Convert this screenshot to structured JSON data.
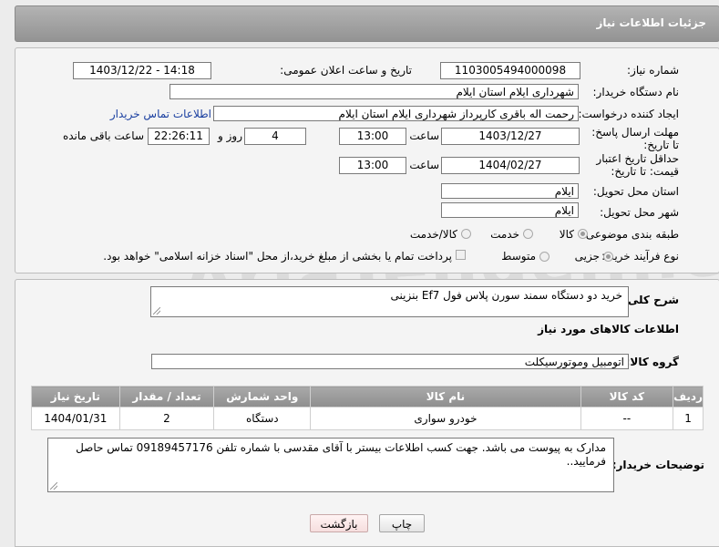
{
  "header": {
    "title": "جزئیات اطلاعات نیاز"
  },
  "labels": {
    "need_number": "شماره نیاز:",
    "announce_datetime": "تاریخ و ساعت اعلان عمومی:",
    "buyer_org": "نام دستگاه خریدار:",
    "requester": "ایجاد کننده درخواست:",
    "contact_link": "اطلاعات تماس خریدار",
    "reply_deadline": "مهلت ارسال پاسخ: تا تاریخ:",
    "price_validity": "حداقل تاریخ اعتبار قیمت: تا تاریخ:",
    "time": "ساعت",
    "day_and": "روز و",
    "remaining": "ساعت باقی مانده",
    "delivery_province": "استان محل تحویل:",
    "delivery_city": "شهر محل تحویل:",
    "category": "طبقه بندی موضوعی:",
    "purchase_type": "نوع فرآیند خرید :",
    "need_desc": "شرح کلی نیاز:",
    "goods_info": "اطلاعات کالاهای مورد نیاز",
    "goods_group": "گروه کالا:",
    "buyer_notes": "توضیحات خریدار:"
  },
  "values": {
    "need_number": "1103005494000098",
    "announce_datetime": "1403/12/22 - 14:18",
    "buyer_org": "شهرداری ایلام استان ایلام",
    "requester": "رحمت اله باقری کارپرداز شهرداری ایلام استان ایلام",
    "reply_date": "1403/12/27",
    "reply_time": "13:00",
    "days": "4",
    "remaining_time": "22:26:11",
    "validity_date": "1404/02/27",
    "validity_time": "13:00",
    "delivery_province": "ایلام",
    "delivery_city": "ایلام",
    "need_desc": "خرید دو دستگاه سمند سورن پلاس فول  Ef7 بنزینی",
    "goods_group": "اتومبیل وموتورسیکلت",
    "buyer_notes": "مدارک به پیوست می باشد. جهت کسب اطلاعات بیستر با آقای مقدسی با شماره تلفن 09189457176 تماس حاصل فرمایید.."
  },
  "category_options": {
    "goods": "کالا",
    "service": "خدمت",
    "goods_service": "کالا/خدمت",
    "selected": "کالا"
  },
  "purchase_options": {
    "minor": "جزیی",
    "medium": "متوسط",
    "treasury_note": "پرداخت تمام یا بخشی از مبلغ خرید،از محل \"اسناد خزانه اسلامی\" خواهد بود.",
    "selected": "جزیی"
  },
  "table": {
    "headers": [
      "ردیف",
      "کد کالا",
      "نام کالا",
      "واحد شمارش",
      "تعداد / مقدار",
      "تاریخ نیاز"
    ],
    "rows": [
      [
        "1",
        "--",
        "خودرو سواری",
        "دستگاه",
        "2",
        "1404/01/31"
      ]
    ]
  },
  "buttons": {
    "print": "چاپ",
    "back": "بازگشت"
  },
  "watermark": "AriaTender.neT",
  "colors": {
    "header": "#a3a3a3",
    "link": "#1a3fa0",
    "back_button": "#f6dede"
  }
}
